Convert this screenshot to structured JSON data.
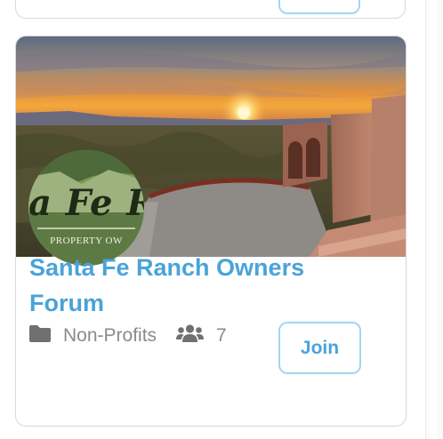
{
  "group": {
    "name": "Santa Fe Ranch Owners Forum",
    "category": "Non-Profits",
    "member_count": "7",
    "join_label": "Join",
    "logo_text": {
      "word": "a Fe R",
      "sub": "PROPERTY OW"
    }
  },
  "icons": {
    "category": "folder-icon",
    "members": "users-icon"
  },
  "colors": {
    "accent": "#4aa3d8",
    "button_border": "#9fd8ee",
    "meta_text": "#8a8a8a",
    "card_border": "#d9d9d9"
  }
}
